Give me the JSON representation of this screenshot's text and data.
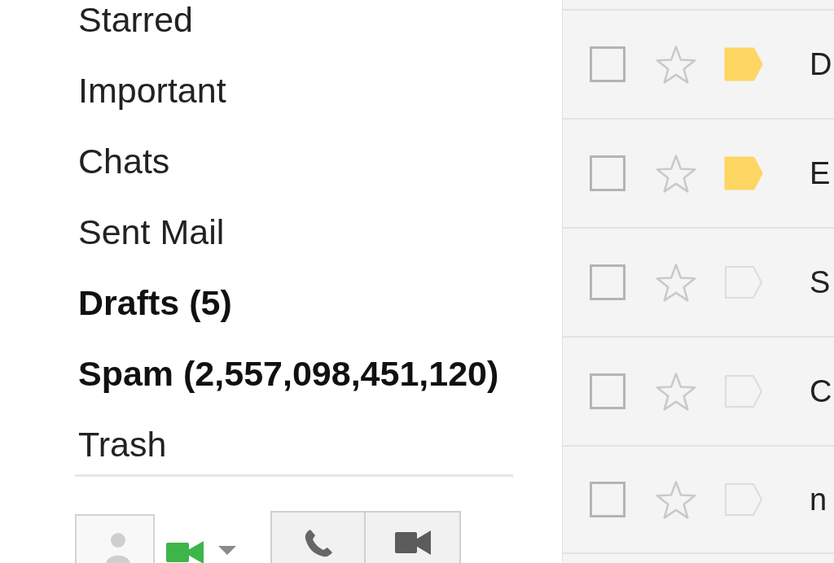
{
  "sidebar": {
    "items": [
      {
        "label": "Starred",
        "unread": false,
        "selected": false
      },
      {
        "label": "Important",
        "unread": false,
        "selected": false
      },
      {
        "label": "Chats",
        "unread": false,
        "selected": false
      },
      {
        "label": "Sent Mail",
        "unread": false,
        "selected": false
      },
      {
        "label": "Drafts (5)",
        "unread": true,
        "selected": false
      },
      {
        "label": "Spam (2,557,098,451,120)",
        "unread": true,
        "selected": false
      },
      {
        "label": "Trash",
        "unread": false,
        "selected": false
      }
    ]
  },
  "message_list": {
    "rows": [
      {
        "checked": false,
        "starred": false,
        "important": true,
        "unread": false,
        "column_4": "D"
      },
      {
        "checked": false,
        "starred": false,
        "important": true,
        "unread": false,
        "column_4": "E"
      },
      {
        "checked": false,
        "starred": false,
        "important": false,
        "unread": false,
        "column_4": "S"
      },
      {
        "checked": false,
        "starred": false,
        "important": false,
        "unread": false,
        "column_4": "C"
      },
      {
        "checked": false,
        "starred": false,
        "important": false,
        "unread": false,
        "column_4": "n"
      }
    ]
  }
}
